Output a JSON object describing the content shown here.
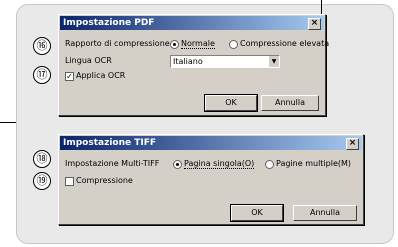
{
  "callouts": [
    "⑯",
    "⑰",
    "⑱",
    "⑲"
  ],
  "pdf_dialog": {
    "title": "Impostazione PDF",
    "close": "×",
    "compression_label": "Rapporto di compressione:",
    "compression_options": [
      {
        "label": "Normale",
        "selected": true
      },
      {
        "label": "Compressione elevata",
        "selected": false
      }
    ],
    "ocr_language_label": "Lingua OCR",
    "ocr_language_value": "Italiano",
    "apply_ocr_label": "Applica OCR",
    "apply_ocr_checked": true,
    "ok_label": "OK",
    "cancel_label": "Annulla"
  },
  "tiff_dialog": {
    "title": "Impostazione TIFF",
    "close": "×",
    "multi_tiff_label": "Impostazione Multi-TIFF",
    "page_options": [
      {
        "label": "Pagina singola(O)",
        "selected": true
      },
      {
        "label": "Pagine multiple(M)",
        "selected": false
      }
    ],
    "compression_label": "Compressione",
    "compression_checked": false,
    "ok_label": "OK",
    "cancel_label": "Annulla"
  },
  "colors": {
    "titlebar_start": "#0a246a",
    "titlebar_end": "#a6caf0",
    "dialog_face": "#d4d0c8",
    "panel": "#e9e9e9"
  }
}
